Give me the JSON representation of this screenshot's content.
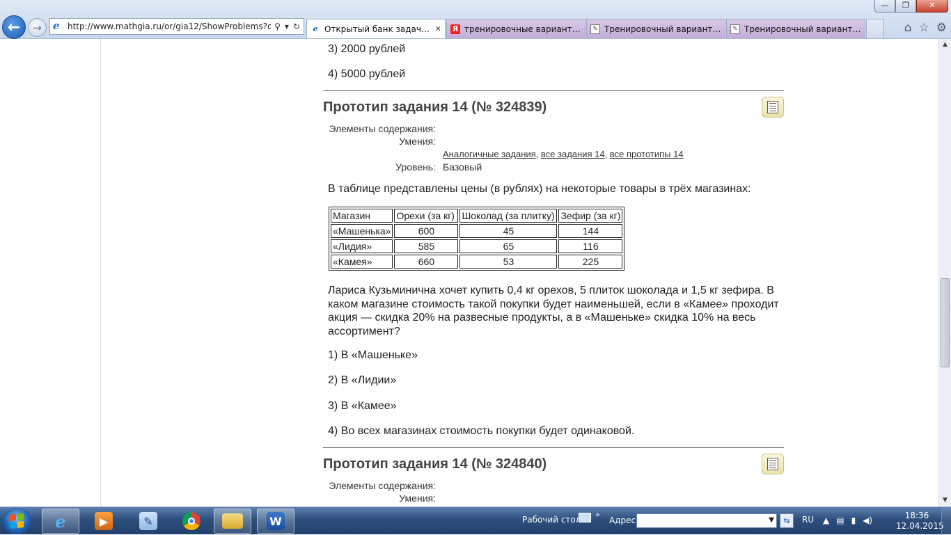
{
  "browser": {
    "window_title": "",
    "address_url": "http://www.mathgia.ru/or/gia12/ShowProblems?offse",
    "tabs": [
      {
        "label": "Открытый банк задач ГИА...",
        "active": true
      },
      {
        "label": "тренировочные варианты ог...",
        "active": false
      },
      {
        "label": "Тренировочный вариант ОГЭ...",
        "active": false
      },
      {
        "label": "Тренировочный вариант ОГЭ...",
        "active": false
      }
    ]
  },
  "page": {
    "prev_answers": [
      "3) 2000 рублей",
      "4) 5000 рублей"
    ],
    "problem1": {
      "title": "Прототип задания 14 (№ 324839)",
      "meta_content_label": "Элементы содержания:",
      "meta_skills_label": "Умения:",
      "links": {
        "similar": "Аналогичные задания",
        "sep": ",",
        "all_tasks": "все задания 14",
        "all_prototypes": "все прототипы 14"
      },
      "level_label": "Уровень:",
      "level_value": "Базовый",
      "intro": "В таблице представлены цены (в рублях) на некоторые товары в трёх магазинах:",
      "table": {
        "headers": [
          "Магазин",
          "Орехи (за кг)",
          "Шоколад (за плитку)",
          "Зефир (за кг)"
        ],
        "rows": [
          [
            "«Машенька»",
            "600",
            "45",
            "144"
          ],
          [
            "«Лидия»",
            "585",
            "65",
            "116"
          ],
          [
            "«Камея»",
            "660",
            "53",
            "225"
          ]
        ]
      },
      "question": "Лариса Кузьминична хочет купить 0,4 кг орехов, 5 плиток шоколада и 1,5 кг зефира. В каком магазине стоимость такой покупки будет наименьшей, если в «Камее» проходит акция — скидка 20% на развесные продукты, а в «Машеньке» скидка 10% на весь ассортимент?",
      "answers": [
        "1) В «Машеньке»",
        "2) В «Лидии»",
        "3) В «Камее»",
        "4) Во всех магазинах стоимость покупки будет одинаковой."
      ]
    },
    "problem2": {
      "title": "Прототип задания 14 (№ 324840)",
      "meta_content_label": "Элементы содержания:",
      "meta_skills_label": "Умения:"
    }
  },
  "taskbar": {
    "desktop_label": "Рабочий стол",
    "address_label": "Адрес",
    "lang": "RU",
    "time": "18:36",
    "date": "12.04.2015"
  }
}
